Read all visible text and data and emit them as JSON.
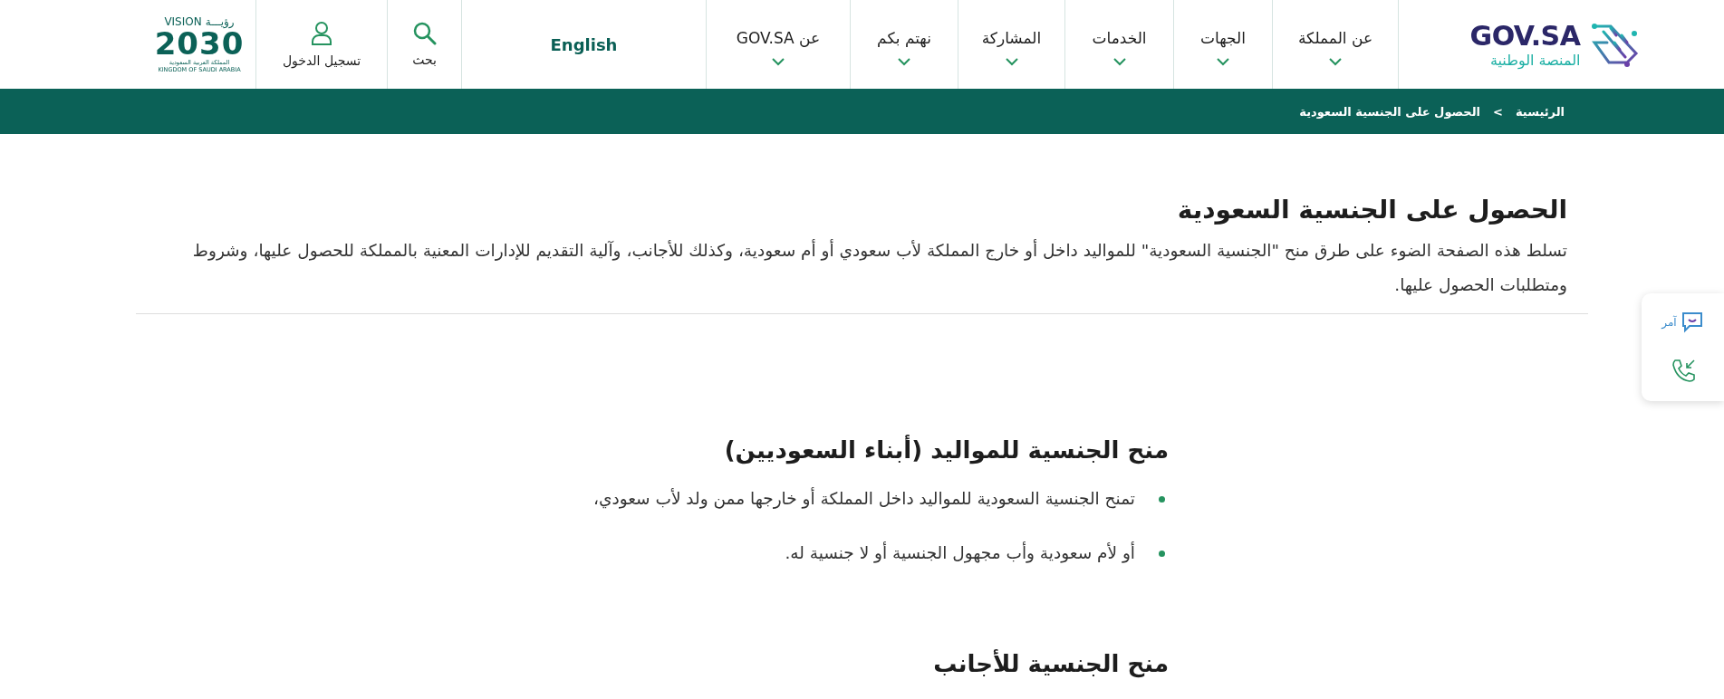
{
  "header": {
    "logo": {
      "name": "GOV.SA",
      "subtitle": "المنصة الوطنية"
    },
    "nav": [
      {
        "label": "عن المملكة",
        "expanded": false
      },
      {
        "label": "الجهات",
        "expanded": false
      },
      {
        "label": "الخدمات",
        "expanded": false
      },
      {
        "label": "المشاركة",
        "expanded": false
      },
      {
        "label": "نهتم بكم",
        "expanded": false
      },
      {
        "label": "عن GOV.SA",
        "expanded": false
      }
    ],
    "language": "English",
    "search": "بحث",
    "login": "تسجيل الدخول",
    "vision": {
      "top_en": "VISION",
      "top_ar": "رؤيـــة",
      "year": "2030",
      "ar": "المملكة العربية السعودية",
      "en": "KINGDOM OF SAUDI ARABIA"
    }
  },
  "breadcrumb": [
    {
      "label": "الرئيسية"
    },
    {
      "label": "الحصول على الجنسية السعودية"
    }
  ],
  "breadcrumb_separator": ">",
  "intro": {
    "title": "الحصول على الجنسية السعودية",
    "text": "تسلط هذه الصفحة الضوء على طرق منح \"الجنسية السعودية\" للمواليد داخل أو خارج المملكة لأب سعودي أو أم سعودية، وكذلك للأجانب، وآلية التقديم للإدارات المعنية بالمملكة للحصول عليها، وشروط ومتطلبات الحصول عليها."
  },
  "sections": [
    {
      "heading": "منح الجنسية للمواليد (أبناء السعوديين)",
      "items": [
        "تمنح الجنسية السعودية للمواليد داخل المملكة أو خارجها ممن ولد لأب سعودي،",
        "أو لأم سعودية وأب مجهول الجنسية أو لا جنسية له."
      ]
    },
    {
      "heading": "منح الجنسية للأجانب"
    }
  ],
  "help_widget": {
    "label": "آمر"
  }
}
